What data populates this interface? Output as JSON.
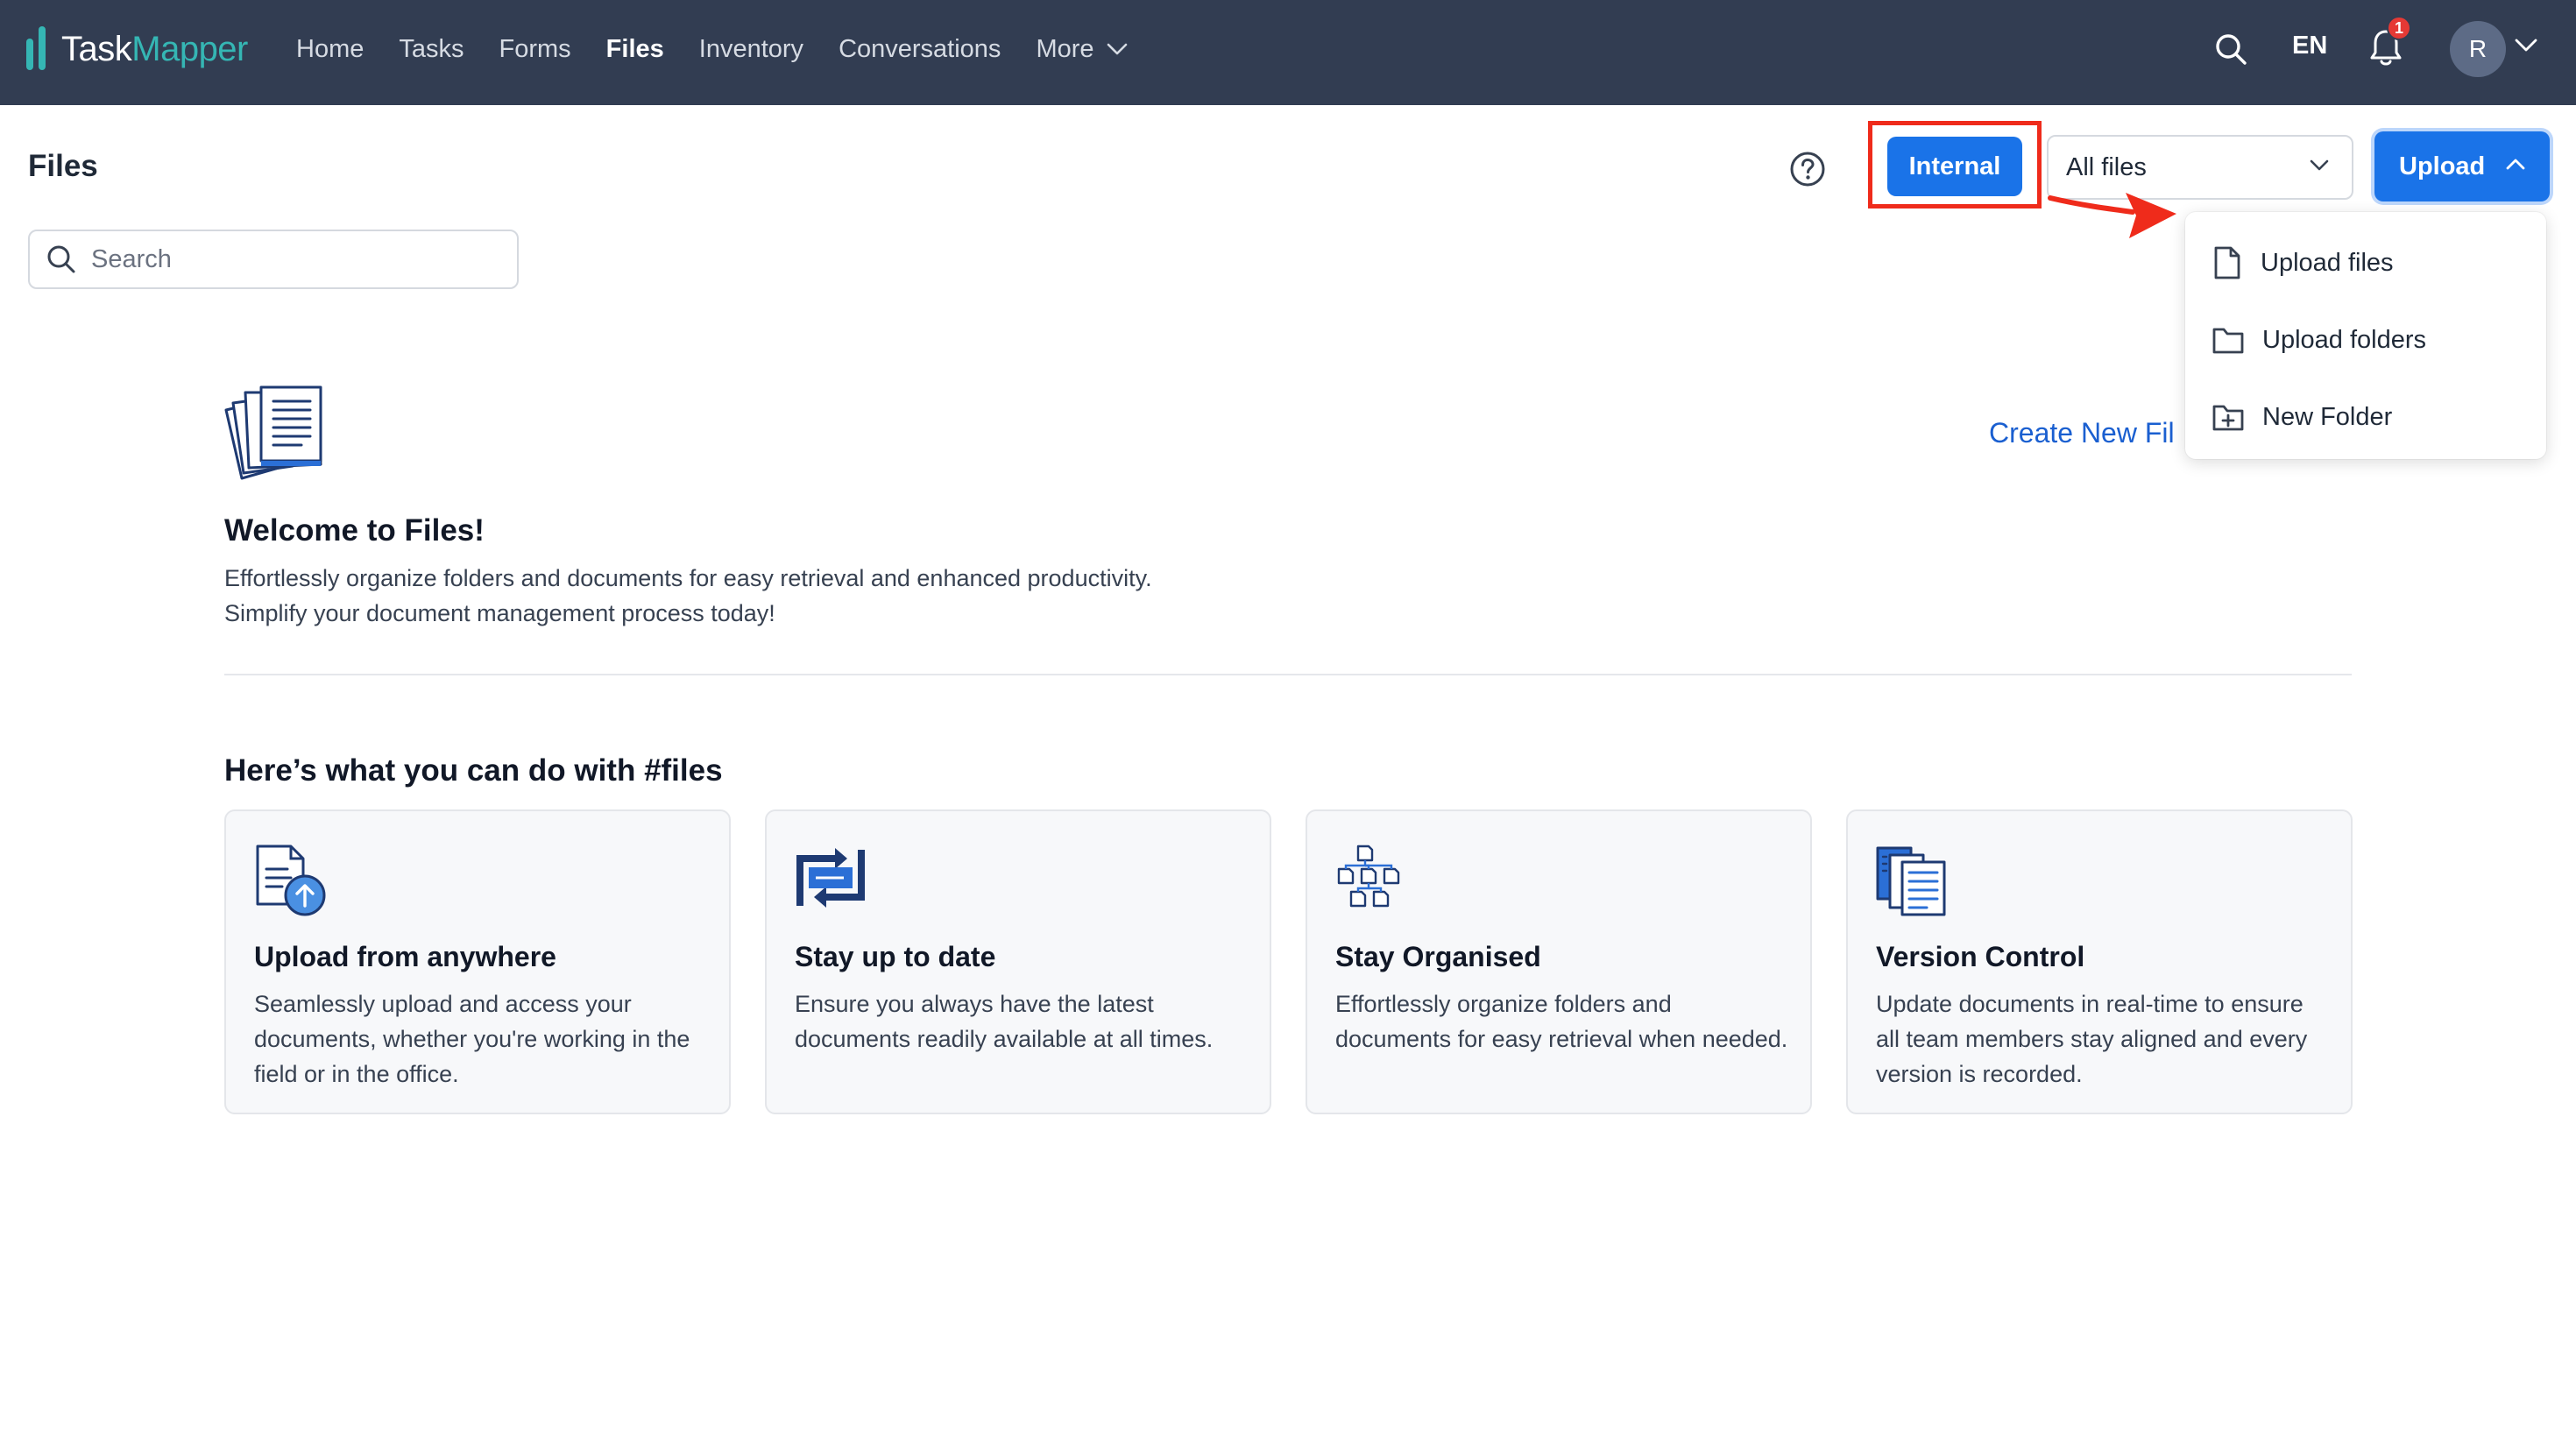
{
  "brand": {
    "name_part1": "Task",
    "name_part2": "Mapper",
    "accent_color": "#35b6b4"
  },
  "nav": {
    "items": [
      {
        "label": "Home"
      },
      {
        "label": "Tasks"
      },
      {
        "label": "Forms"
      },
      {
        "label": "Files",
        "active": true
      },
      {
        "label": "Inventory"
      },
      {
        "label": "Conversations"
      },
      {
        "label": "More"
      }
    ],
    "language": "EN",
    "notification_count": "1",
    "avatar_initial": "R",
    "background_color": "#323d52"
  },
  "page": {
    "title": "Files",
    "internal_button": "Internal",
    "filter_select": "All files",
    "upload_button": "Upload",
    "search_placeholder": "Search",
    "create_new_link": "Create New Fil"
  },
  "upload_menu": {
    "items": [
      {
        "label": "Upload files",
        "icon": "file-icon"
      },
      {
        "label": "Upload folders",
        "icon": "folder-icon"
      },
      {
        "label": "New Folder",
        "icon": "folder-plus-icon"
      }
    ]
  },
  "welcome": {
    "title": "Welcome to Files!",
    "description": "Effortlessly organize folders and documents for easy retrieval and enhanced productivity. Simplify your document management process today!"
  },
  "features": {
    "heading": "Here’s what you can do with #files",
    "cards": [
      {
        "title": "Upload from anywhere",
        "description": "Seamlessly upload and access your documents, whether you're working in the field or in the office.",
        "icon": "document-upload-icon"
      },
      {
        "title": "Stay up to date",
        "description": "Ensure you always have the latest documents readily available at all times.",
        "icon": "sync-arrows-icon"
      },
      {
        "title": "Stay Organised",
        "description": "Effortlessly organize folders and documents for easy retrieval when needed.",
        "icon": "hierarchy-icon"
      },
      {
        "title": "Version Control",
        "description": "Update documents in real-time to ensure all team members stay aligned and every version is recorded.",
        "icon": "versions-icon"
      }
    ]
  },
  "colors": {
    "primary": "#1a73e8",
    "annotation": "#ef2b1b",
    "link": "#1a5fd0"
  }
}
